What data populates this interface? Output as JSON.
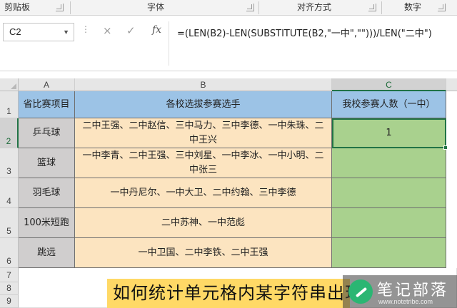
{
  "ribbon": {
    "groups": [
      "剪贴板",
      "字体",
      "对齐方式",
      "数字"
    ]
  },
  "formula_bar": {
    "name_box": "C2",
    "cancel_icon": "×",
    "confirm_icon": "✓",
    "fx_label": "fx",
    "formula": "=(LEN(B2)-LEN(SUBSTITUTE(B2,\"一中\",\"\")))/LEN(\"二中\")"
  },
  "sheet": {
    "columns": [
      "A",
      "B",
      "C"
    ],
    "selected_cell": "C2",
    "rows": [
      {
        "row": "1",
        "project": "省比赛项目",
        "players": "各校选拔参赛选手",
        "count": "我校参赛人数（一中）"
      },
      {
        "row": "2",
        "project": "乒乓球",
        "players": "二中王强、二中赵信、三中马力、三中李德、一中朱珠、二中王兴",
        "count": "1"
      },
      {
        "row": "3",
        "project": "篮球",
        "players": "一中李青、二中王强、三中刘星、一中李冰、一中小明、二中张三",
        "count": ""
      },
      {
        "row": "4",
        "project": "羽毛球",
        "players": "一中丹尼尔、一中大卫、二中约翰、三中李德",
        "count": ""
      },
      {
        "row": "5",
        "project": "100米短跑",
        "players": "二中苏神、一中范彪",
        "count": ""
      },
      {
        "row": "6",
        "project": "跳远",
        "players": "一中卫国、二中李铁、二中王强",
        "count": ""
      },
      {
        "row": "7"
      },
      {
        "row": "8"
      },
      {
        "row": "9"
      }
    ]
  },
  "overlay": {
    "caption": "如何统计单元格内某字符串出现",
    "watermark_title": "笔记部落",
    "watermark_url": "www.notetribe.com"
  },
  "colors": {
    "header_fill": "#9cc3e6",
    "project_fill": "#d0cece",
    "names_fill": "#fce4c0",
    "count_fill": "#a9d18e",
    "selection": "#217346",
    "caption_fill": "#ffd966"
  }
}
